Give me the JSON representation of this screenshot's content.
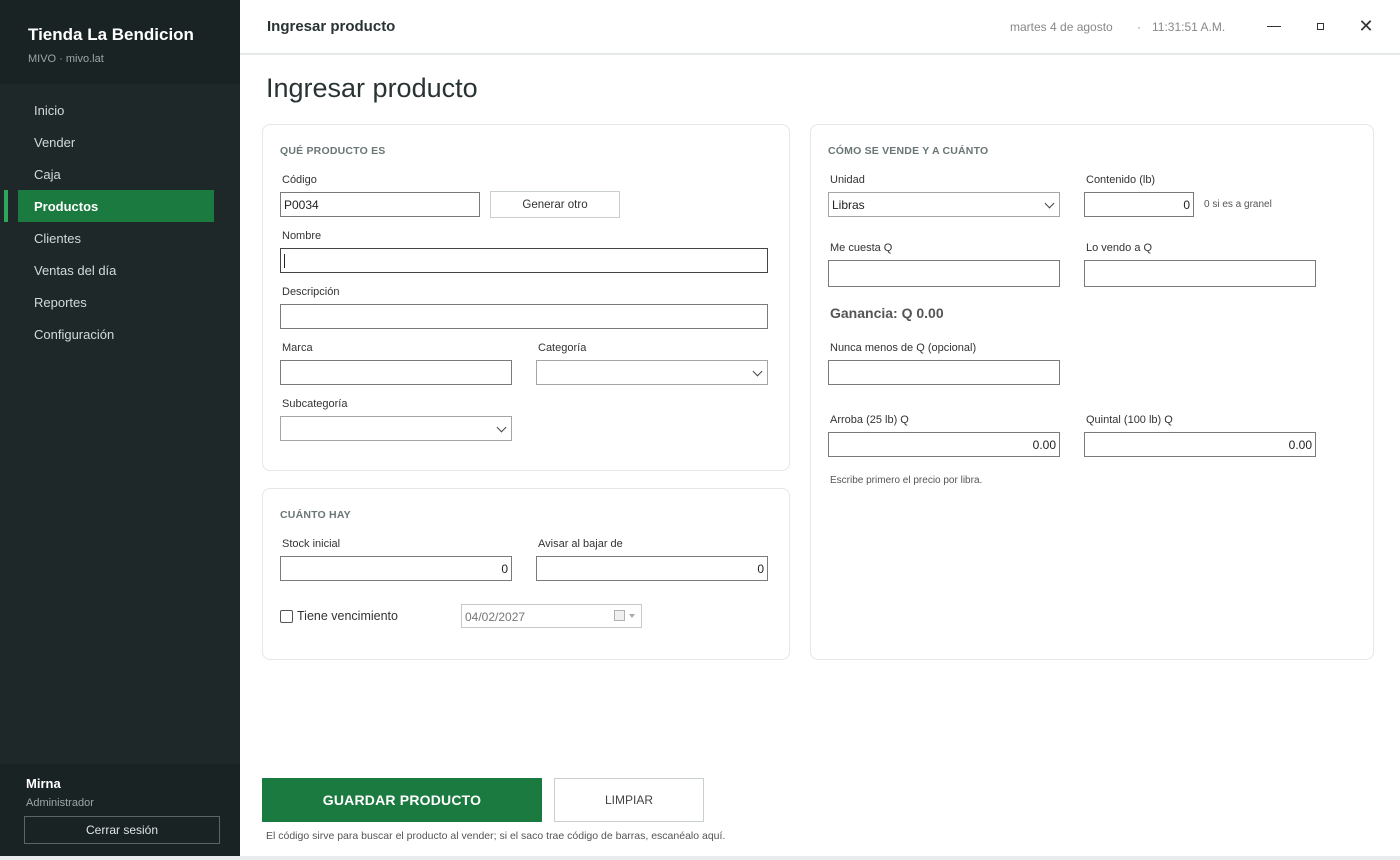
{
  "sidebar": {
    "brand_name": "Tienda La Bendicion",
    "brand_sub": "MIVO · mivo.lat",
    "nav": [
      "Inicio",
      "Vender",
      "Caja",
      "Productos",
      "Clientes",
      "Ventas del día",
      "Reportes",
      "Configuración"
    ],
    "active_item": "Productos",
    "user_name": "Mirna",
    "user_role": "Administrador",
    "logout_label": "Cerrar sesión"
  },
  "topbar": {
    "title": "Ingresar producto",
    "date": "martes 4 de agosto",
    "separator": "·",
    "time": "11:31:51 A.M."
  },
  "page": {
    "title": "Ingresar producto"
  },
  "product": {
    "heading": "QUÉ PRODUCTO ES",
    "code_label": "Código",
    "code_value": "P0034",
    "generate_label": "Generar otro",
    "name_label": "Nombre",
    "name_value": "",
    "description_label": "Descripción",
    "description_value": "",
    "brand_label": "Marca",
    "brand_value": "",
    "category_label": "Categoría",
    "category_value": "",
    "subcategory_label": "Subcategoría",
    "subcategory_value": ""
  },
  "stock": {
    "heading": "CUÁNTO HAY",
    "initial_label": "Stock inicial",
    "initial_value": "0",
    "alert_label": "Avisar al bajar de",
    "alert_value": "0",
    "expiry_label": "Tiene vencimiento",
    "expiry_checked": false,
    "expiry_date": "04/02/2027"
  },
  "pricing": {
    "heading": "CÓMO SE VENDE Y A CUÁNTO",
    "unit_label": "Unidad",
    "unit_value": "Libras",
    "content_label": "Contenido (lb)",
    "content_value": "0",
    "content_hint": "0 si es a granel",
    "cost_label": "Me cuesta Q",
    "cost_value": "",
    "price_label": "Lo vendo a Q",
    "price_value": "",
    "profit_text": "Ganancia: Q 0.00",
    "min_label": "Nunca menos de Q (opcional)",
    "min_value": "",
    "arroba_label": "Arroba (25 lb) Q",
    "arroba_value": "0.00",
    "quintal_label": "Quintal (100 lb) Q",
    "quintal_value": "0.00",
    "note": "Escribe primero el precio por libra."
  },
  "actions": {
    "save_label": "GUARDAR PRODUCTO",
    "clear_label": "LIMPIAR",
    "footnote": "El código sirve para buscar el producto al vender; si el saco trae código de barras, escanéalo aquí."
  },
  "colors": {
    "accent": "#1b7a3f",
    "sidebar": "#1e2828"
  }
}
